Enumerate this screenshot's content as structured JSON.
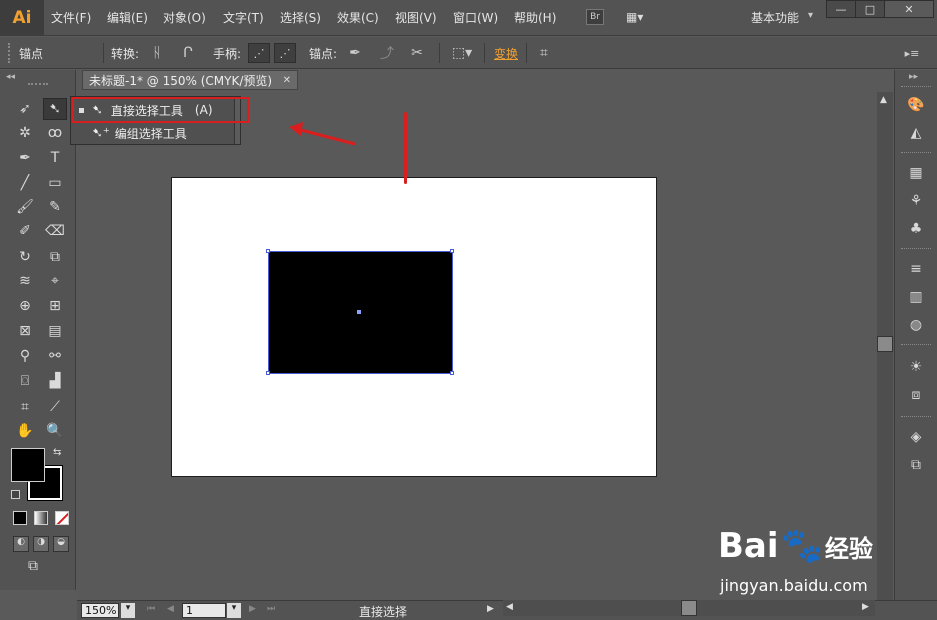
{
  "app": {
    "logo": "Ai"
  },
  "menubar": {
    "items": [
      "文件(F)",
      "编辑(E)",
      "对象(O)",
      "文字(T)",
      "选择(S)",
      "效果(C)",
      "视图(V)",
      "窗口(W)",
      "帮助(H)"
    ],
    "bridge_label": "Br",
    "workspace": "基本功能"
  },
  "controlbar": {
    "tool_name": "锚点",
    "convert_label": "转换:",
    "handles_label": "手柄:",
    "anchors_label": "锚点:",
    "transform_label": "变换"
  },
  "document": {
    "tab_title": "未标题-1* @ 150% (CMYK/预览)"
  },
  "flyout": {
    "items": [
      {
        "label": "直接选择工具",
        "shortcut": "(A)"
      },
      {
        "label": "编组选择工具",
        "shortcut": ""
      }
    ]
  },
  "statusbar": {
    "zoom": "150%",
    "page": "1",
    "current_tool": "直接选择"
  },
  "watermark": {
    "brand": "Bai",
    "brand_suffix": "经验",
    "url": "jingyan.baidu.com"
  },
  "colors": {
    "annotation_red": "#d81e1e",
    "selection_blue": "#4a5bd6",
    "accent_orange": "#f0a030"
  }
}
